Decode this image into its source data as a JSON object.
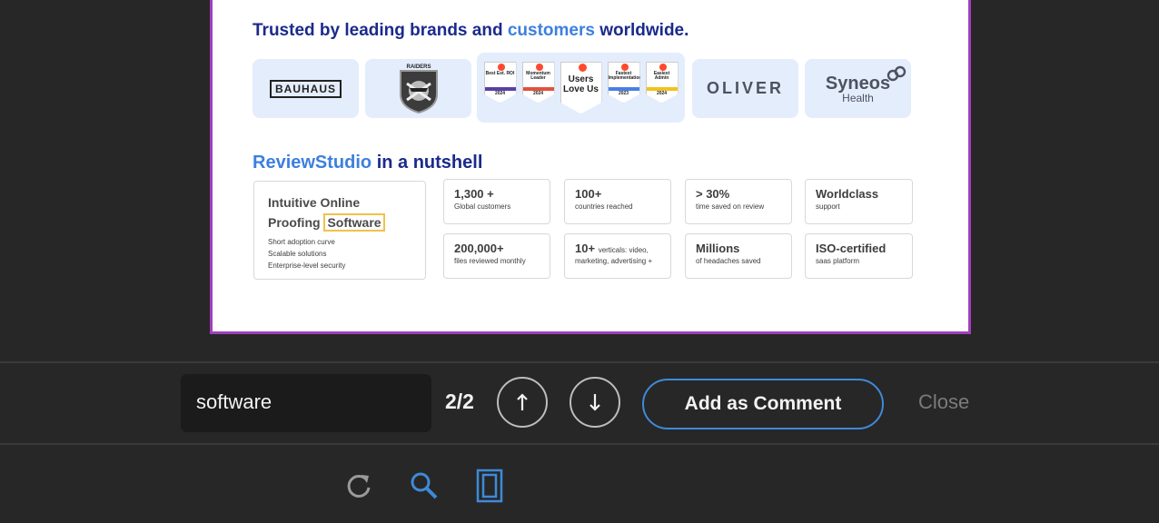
{
  "document": {
    "headline1": {
      "prefix": "Trusted by leading brands and ",
      "accent": "customers",
      "suffix": " worldwide."
    },
    "logos": {
      "bauhaus": "BAUHAUS",
      "raiders": "RAIDERS",
      "oliver": "OLIVER",
      "syneos": "Syneos",
      "syneos_sub": "Health"
    },
    "badges": [
      {
        "label": "Best Est. ROI",
        "year": "2024",
        "stripe": "#5b3fa6"
      },
      {
        "label": "Momentum Leader",
        "year": "2024",
        "stripe": "#e2523c"
      },
      {
        "label": "Users Love Us",
        "year": "",
        "stripe": ""
      },
      {
        "label": "Fastest Implementation",
        "year": "2023",
        "stripe": "#4a7ee6"
      },
      {
        "label": "Easiest Admin",
        "year": "2024",
        "stripe": "#f3c21b"
      }
    ],
    "headline2": {
      "accent": "ReviewStudio",
      "suffix": " in a nutshell"
    },
    "intro": {
      "line1": "Intuitive Online",
      "line2_prefix": "Proofing ",
      "line2_highlight": "Software",
      "bullets": [
        "Short adoption curve",
        "Scalable solutions",
        "Enterprise-level security"
      ]
    },
    "stats": [
      {
        "big": "1,300 +",
        "small": "Global customers"
      },
      {
        "big": "100+",
        "small": "countries reached"
      },
      {
        "big": "> 30%",
        "small": "time saved on  review"
      },
      {
        "big": "Worldclass",
        "small": "support"
      },
      {
        "big": "200,000+",
        "small": "files reviewed monthly"
      },
      {
        "big": "10+",
        "small": "verticals: video,",
        "small2": "marketing, advertising +"
      },
      {
        "big": "Millions",
        "small": "of headaches saved"
      },
      {
        "big": "ISO-certified",
        "small": "saas platform"
      }
    ]
  },
  "findbar": {
    "search_value": "software",
    "counter": "2/2",
    "prev_icon": "arrow-up-icon",
    "next_icon": "arrow-down-icon",
    "add_comment_label": "Add as Comment",
    "close_label": "Close"
  },
  "toolbar": {
    "icons": [
      "refresh-icon",
      "search-icon",
      "page-view-icon"
    ],
    "accent_color": "#3f8ad8"
  }
}
